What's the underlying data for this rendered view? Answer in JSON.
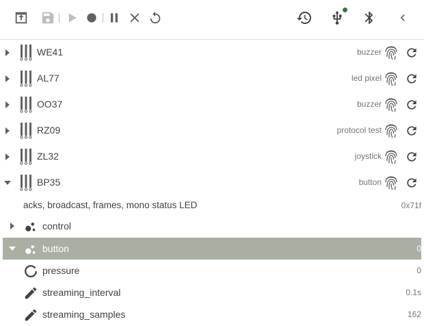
{
  "toolbar": {
    "icons": [
      "upload-icon",
      "save-icon",
      "play-icon",
      "record-icon",
      "pause-icon",
      "close-icon",
      "reset-icon",
      "history-icon",
      "usb-icon",
      "bluetooth-icon",
      "chevron-left-icon"
    ],
    "usb_status_color": "#2e7d32"
  },
  "devices": [
    {
      "name": "WE41",
      "tag": "buzzer",
      "expanded": false
    },
    {
      "name": "AL77",
      "tag": "led pixel",
      "expanded": false
    },
    {
      "name": "OO37",
      "tag": "buzzer",
      "expanded": false
    },
    {
      "name": "RZ09",
      "tag": "protocol test",
      "expanded": false
    },
    {
      "name": "ZL32",
      "tag": "joystick",
      "expanded": false
    },
    {
      "name": "BP35",
      "tag": "button",
      "expanded": true
    }
  ],
  "device_detail": {
    "description": "acks, broadcast, frames, mono status LED",
    "value": "0x71f"
  },
  "services": [
    {
      "name": "control",
      "value": "",
      "expanded": false,
      "selected": false,
      "icon": "service-icon"
    },
    {
      "name": "button",
      "value": "0",
      "expanded": true,
      "selected": true,
      "icon": "service-icon"
    }
  ],
  "registers": [
    {
      "name": "pressure",
      "value": "0",
      "icon": "gauge-ring-icon"
    },
    {
      "name": "streaming_interval",
      "value": "0.1s",
      "icon": "pencil-icon"
    },
    {
      "name": "streaming_samples",
      "value": "162",
      "icon": "pencil-icon"
    }
  ],
  "colors": {
    "selected_row": "#a9b0a3",
    "icon": "#616161",
    "disabled_icon": "#bdbdbd"
  }
}
